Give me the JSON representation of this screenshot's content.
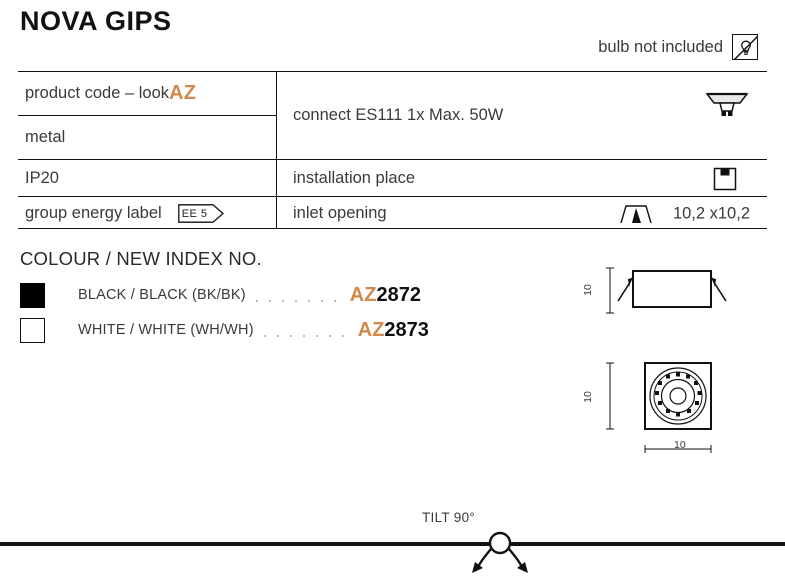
{
  "header": {
    "title": "NOVA GIPS",
    "bulb_note": "bulb not included",
    "bulb_icon": "bulb-crossed-out-icon"
  },
  "spec_table": {
    "left_rows": [
      {
        "label": "product code – look ",
        "accent": "AZ"
      },
      {
        "label": "metal"
      },
      {
        "label": "IP20"
      },
      {
        "label": "group energy label",
        "badge": "EE 5"
      }
    ],
    "right_rows": [
      {
        "label": "connect ES111 1x Max. 50W",
        "icon": "es111-lamp-icon"
      },
      {
        "label": "installation place",
        "icon": "ceiling-recessed-icon"
      },
      {
        "label": "inlet opening",
        "icon": "inlet-trapezoid-icon",
        "value": "10,2 x10,2"
      }
    ]
  },
  "colour_section": {
    "heading": "COLOUR / NEW INDEX NO.",
    "rows": [
      {
        "swatch": "black",
        "name": "BLACK / BLACK (BK/BK)",
        "prefix": "AZ",
        "number": "2872"
      },
      {
        "swatch": "white",
        "name": "WHITE / WHITE (WH/WH)",
        "prefix": "AZ",
        "number": "2873"
      }
    ]
  },
  "drawings": {
    "side_view": {
      "name": "side-view-drawing",
      "height_dim": "10"
    },
    "front_view": {
      "name": "front-view-drawing",
      "height_dim": "10",
      "width_dim": "10"
    }
  },
  "footer": {
    "tilt_label": "TILT 90°",
    "tilt_icon": "tilt-rotation-icon"
  },
  "colors": {
    "accent": "#d2894a",
    "ink": "#111111",
    "text": "#3a3a3a"
  }
}
